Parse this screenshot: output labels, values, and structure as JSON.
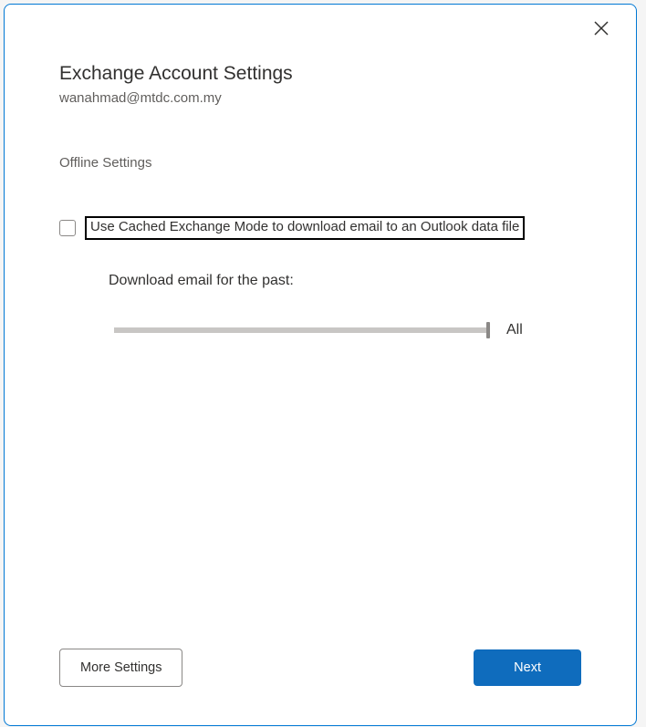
{
  "dialog": {
    "title": "Exchange Account Settings",
    "email": "wanahmad@mtdc.com.my",
    "section_label": "Offline Settings",
    "cached_mode": {
      "checked": false,
      "label": "Use Cached Exchange Mode to download email to an Outlook data file"
    },
    "download_label": "Download email for the past:",
    "slider": {
      "value_label": "All"
    },
    "buttons": {
      "more_settings": "More Settings",
      "next": "Next"
    }
  }
}
